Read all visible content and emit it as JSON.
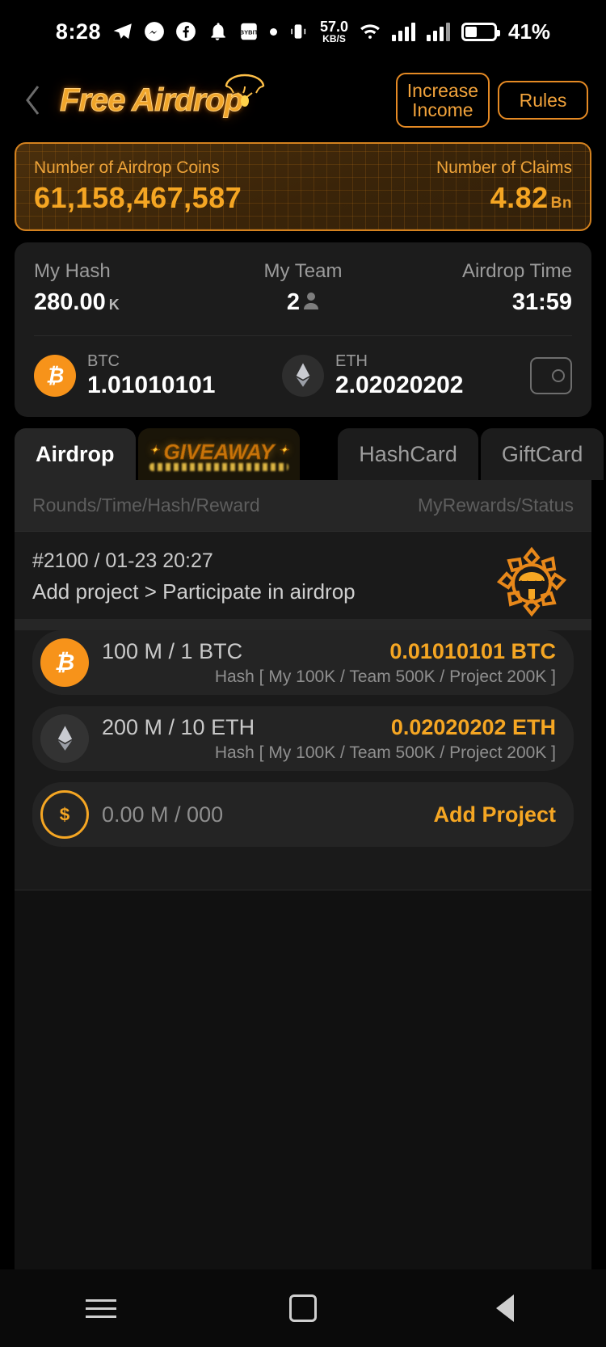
{
  "status_bar": {
    "time": "8:28",
    "icons": [
      "telegram-icon",
      "messenger-icon",
      "facebook-icon",
      "bell-icon",
      "bybit-icon",
      "dot-icon",
      "vibrate-icon"
    ],
    "network_speed_value": "57.0",
    "network_speed_unit": "KB/S",
    "battery_percent": "41%"
  },
  "header": {
    "back_icon": "chevron-left-icon",
    "title": "Free Airdrop",
    "parachute_icon": "parachute-icon",
    "increase_income_line1": "Increase",
    "increase_income_line2": "Income",
    "rules_label": "Rules"
  },
  "banner": {
    "coins_label": "Number of Airdrop Coins",
    "coins_value": "61,158,467,587",
    "claims_label": "Number of Claims",
    "claims_value": "4.82",
    "claims_unit": "Bn"
  },
  "info": {
    "my_hash_label": "My Hash",
    "my_hash_value": "280.00",
    "my_hash_unit": "K",
    "my_team_label": "My Team",
    "my_team_value": "2",
    "airdrop_time_label": "Airdrop Time",
    "airdrop_time_value": "31:59",
    "wallets": [
      {
        "icon": "bitcoin-icon",
        "symbol": "BTC",
        "amount": "1.01010101"
      },
      {
        "icon": "ethereum-icon",
        "symbol": "ETH",
        "amount": "2.02020202"
      }
    ],
    "wallet_icon": "wallet-icon"
  },
  "tabs": [
    {
      "label": "Airdrop",
      "active": true
    },
    {
      "label": "GIVEAWAY",
      "active": false
    },
    {
      "label": "HashCard",
      "active": false
    },
    {
      "label": "GiftCard",
      "active": false
    }
  ],
  "list": {
    "col_left": "Rounds/Time/Hash/Reward",
    "col_right": "MyRewards/Status",
    "round": {
      "id_time": "#2100 / 01-23 20:27",
      "subtitle": "Add project > Participate in airdrop",
      "badge_icon": "airdrop-parachute-badge-icon"
    },
    "rows": [
      {
        "icon": "bitcoin-icon",
        "left": "100 M / 1 BTC",
        "right": "0.01010101 BTC",
        "hash": "Hash [ My 100K / Team 500K / Project 200K ]"
      },
      {
        "icon": "ethereum-icon",
        "left": "200 M / 10 ETH",
        "right": "0.02020202 ETH",
        "hash": "Hash [ My 100K / Team 500K / Project 200K ]"
      },
      {
        "icon": "dollar-icon",
        "left": "0.00 M / 000",
        "right": "Add Project",
        "hash": ""
      }
    ]
  },
  "navbar": {
    "menu_icon": "menu-icon",
    "home_icon": "home-square-icon",
    "back_icon": "back-triangle-icon"
  },
  "colors": {
    "accent": "#f5a623",
    "accent_border": "#e58a24",
    "panel": "#1c1c1c",
    "row": "#242424",
    "background": "#000000"
  }
}
